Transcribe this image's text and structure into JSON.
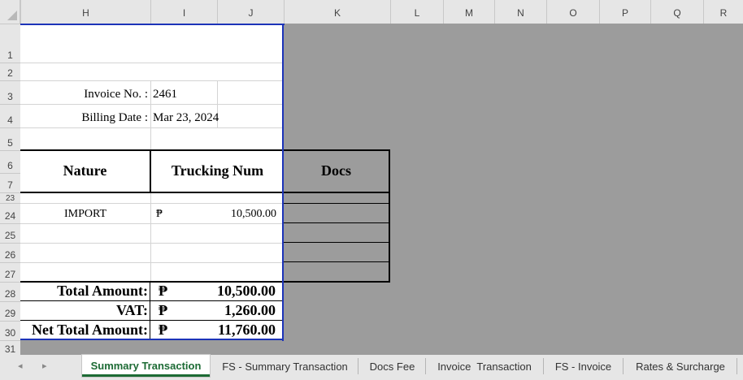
{
  "columns": [
    "H",
    "I",
    "J",
    "K",
    "L",
    "M",
    "N",
    "O",
    "P",
    "Q",
    "R"
  ],
  "rows": [
    "1",
    "2",
    "3",
    "4",
    "5",
    "6",
    "7",
    "23",
    "24",
    "25",
    "26",
    "27",
    "28",
    "29",
    "30",
    "31"
  ],
  "invoice": {
    "no_label": "Invoice No. :",
    "no_value": "2461",
    "date_label": "Billing Date :",
    "date_value": "Mar 23, 2024"
  },
  "table": {
    "headers": [
      "Nature",
      "Trucking Num",
      "Docs"
    ],
    "rows": [
      {
        "nature": "IMPORT",
        "currency": "₱",
        "amount": "10,500.00"
      }
    ]
  },
  "totals": [
    {
      "label": "Total Amount:",
      "currency": "₱",
      "value": "10,500.00"
    },
    {
      "label": "VAT:",
      "currency": "₱",
      "value": "1,260.00"
    },
    {
      "label": "Net Total Amount:",
      "currency": "₱",
      "value": "11,760.00"
    }
  ],
  "tabs": [
    "Summary Transaction",
    "FS - Summary Transaction",
    "Docs Fee",
    "Invoice  Transaction",
    "FS - Invoice",
    "Rates & Surcharge"
  ],
  "active_tab": "Summary Transaction",
  "nav": {
    "prev": "◂",
    "next": "▸"
  },
  "colors": {
    "active_tab_text": "#1d6b35",
    "selection_border": "#1c33b8",
    "gridline": "#d4d4d4",
    "gray_area": "#9c9c9c"
  }
}
